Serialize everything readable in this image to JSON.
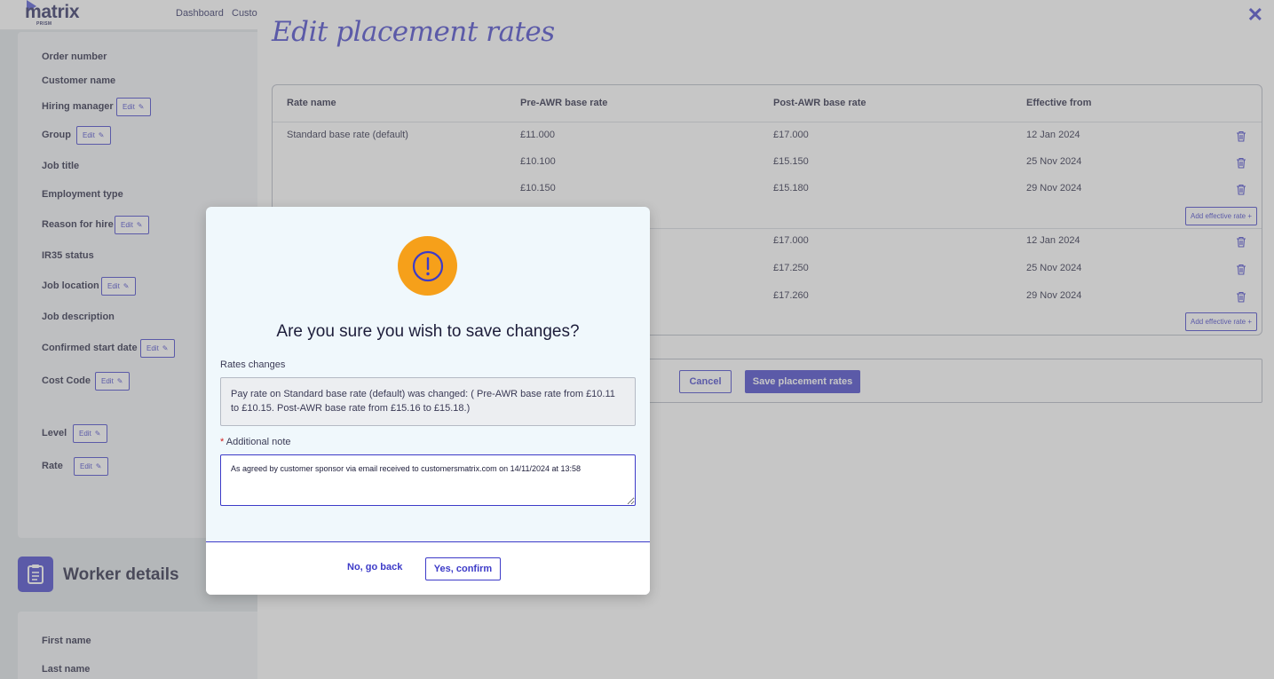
{
  "app": {
    "logo": "matrix",
    "logo_sub": "PRISM",
    "nav": [
      "Dashboard",
      "Custo"
    ]
  },
  "details": {
    "fields": [
      {
        "label": "Order number",
        "edit": ""
      },
      {
        "label": "Customer name",
        "edit": ""
      },
      {
        "label": "Hiring manager",
        "edit": "Edit"
      },
      {
        "label": "Group",
        "edit": "Edit"
      },
      {
        "label": "Job title",
        "edit": ""
      },
      {
        "label": "Employment type",
        "edit": ""
      },
      {
        "label": "Reason for hire",
        "edit": "Edit"
      },
      {
        "label": "IR35 status",
        "edit": ""
      },
      {
        "label": "Job location",
        "edit": "Edit"
      },
      {
        "label": "Job description",
        "edit": ""
      },
      {
        "label": "Confirmed start date",
        "edit": "Edit"
      },
      {
        "label": "Cost Code",
        "edit": "Edit"
      },
      {
        "label": "Level",
        "edit": "Edit"
      },
      {
        "label": "Rate",
        "edit": "Edit"
      }
    ]
  },
  "worker": {
    "title": "Worker details",
    "fields": [
      "First name",
      "Last name"
    ]
  },
  "panel": {
    "title": "Edit placement rates",
    "close": "✕",
    "headers": [
      "Rate name",
      "Pre-AWR base rate",
      "Post-AWR base rate",
      "Effective from"
    ],
    "group1": {
      "name": "Standard base rate (default)",
      "rows": [
        {
          "pre": "£11.000",
          "post": "£17.000",
          "date": "12 Jan 2024"
        },
        {
          "pre": "£10.100",
          "post": "£15.150",
          "date": "25 Nov 2024"
        },
        {
          "pre": "£10.150",
          "post": "£15.180",
          "date": "29 Nov 2024"
        }
      ]
    },
    "group2": {
      "rows": [
        {
          "post": "£17.000",
          "date": "12 Jan 2024"
        },
        {
          "post": "£17.250",
          "date": "25 Nov 2024"
        },
        {
          "post": "£17.260",
          "date": "29 Nov 2024"
        }
      ]
    },
    "add_rate": "Add effective rate +",
    "cancel": "Cancel",
    "save": "Save placement rates"
  },
  "modal": {
    "title": "Are you sure you wish to save changes?",
    "changes_label": "Rates changes",
    "changes_text": "Pay rate on Standard base rate (default) was changed: ( Pre-AWR base rate from £10.11 to £10.15. Post-AWR base rate from £15.16 to £15.18.)",
    "required_mark": "*",
    "note_label": "Additional note",
    "note_value": "As agreed by customer sponsor via email received to customersmatrix.com on 14/11/2024 at 13:58",
    "no": "No, go back",
    "yes": "Yes, confirm"
  },
  "colors": {
    "brand": "#3d3bc8",
    "warning": "#f6a01a"
  }
}
